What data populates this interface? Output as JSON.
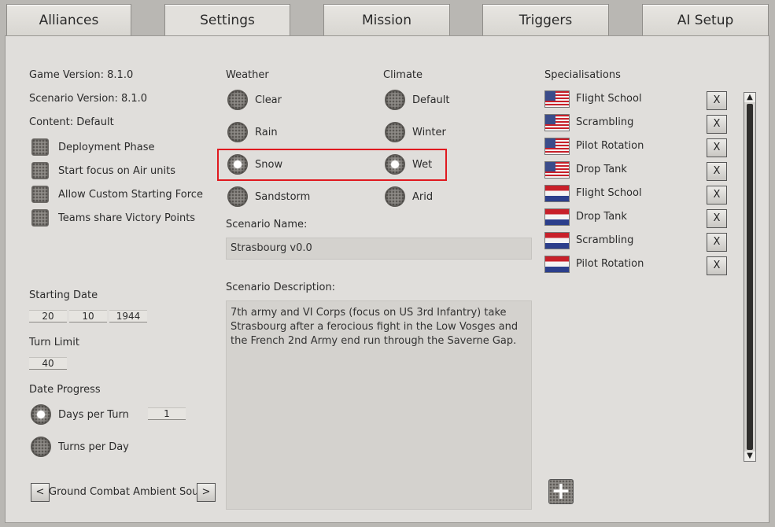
{
  "tabs": [
    "Alliances",
    "Settings",
    "Mission",
    "Triggers",
    "AI Setup"
  ],
  "info": {
    "game_version": "Game Version: 8.1.0",
    "scenario_version": "Scenario Version: 8.1.0",
    "content": "Content: Default"
  },
  "options": [
    "Deployment Phase",
    "Start focus on Air units",
    "Allow Custom Starting Force",
    "Teams share Victory Points"
  ],
  "weather": {
    "label": "Weather",
    "items": [
      "Clear",
      "Rain",
      "Snow",
      "Sandstorm"
    ],
    "selected": "Snow"
  },
  "climate": {
    "label": "Climate",
    "items": [
      "Default",
      "Winter",
      "Wet",
      "Arid"
    ],
    "selected": "Wet"
  },
  "scenario": {
    "name_label": "Scenario Name:",
    "name_value": "Strasbourg v0.0",
    "desc_label": "Scenario Description:",
    "desc_value": "7th army and VI Corps (focus on US 3rd Infantry) take Strasbourg after a ferocious fight in the Low Vosges and the French 2nd Army end run through the Saverne Gap."
  },
  "starting_date": {
    "label": "Starting Date",
    "day": "20",
    "month": "10",
    "year": "1944"
  },
  "turn_limit": {
    "label": "Turn Limit",
    "value": "40"
  },
  "date_progress": {
    "label": "Date Progress",
    "days_per_turn": "Days per Turn",
    "days_value": "1",
    "turns_per_day": "Turns per Day"
  },
  "ambient": {
    "prev": "<",
    "label": "Ground Combat Ambient Sound",
    "next": ">"
  },
  "specialisations": {
    "label": "Specialisations",
    "remove_label": "X",
    "add_label": "+",
    "items": [
      {
        "flag": "us",
        "name": "Flight School"
      },
      {
        "flag": "us",
        "name": "Scrambling"
      },
      {
        "flag": "us",
        "name": "Pilot Rotation"
      },
      {
        "flag": "us",
        "name": "Drop Tank"
      },
      {
        "flag": "nl",
        "name": "Flight School"
      },
      {
        "flag": "nl",
        "name": "Drop Tank"
      },
      {
        "flag": "nl",
        "name": "Scrambling"
      },
      {
        "flag": "nl",
        "name": "Pilot Rotation"
      }
    ]
  },
  "colors": {
    "highlight": "#e0191f",
    "panel": "#e0dedb"
  }
}
